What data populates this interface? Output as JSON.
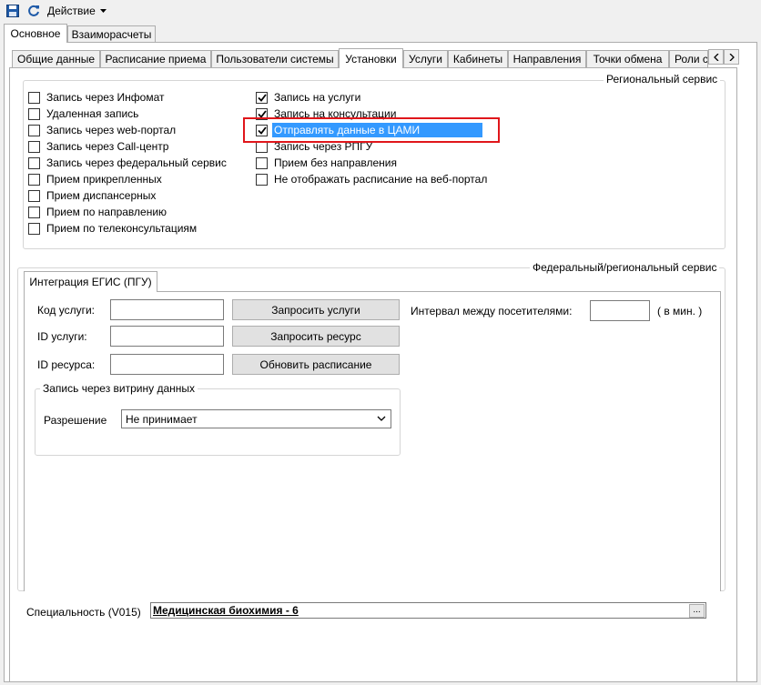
{
  "toolbar": {
    "save_icon": "save-icon",
    "refresh_icon": "refresh-icon",
    "action_label": "Действие"
  },
  "top_tabs": [
    {
      "label": "Основное",
      "active": true
    },
    {
      "label": "Взаиморасчеты",
      "active": false
    }
  ],
  "sub_tabs": [
    {
      "label": "Общие данные"
    },
    {
      "label": "Расписание приема"
    },
    {
      "label": "Пользователи системы"
    },
    {
      "label": "Установки",
      "active": true
    },
    {
      "label": "Услуги"
    },
    {
      "label": "Кабинеты"
    },
    {
      "label": "Направления"
    },
    {
      "label": "Точки обмена"
    },
    {
      "label": "Роли с"
    }
  ],
  "regional": {
    "title": "Региональный сервис",
    "left_checkboxes": [
      {
        "label": "Запись через Инфомат",
        "checked": false
      },
      {
        "label": "Удаленная запись",
        "checked": false
      },
      {
        "label": "Запись через web-портал",
        "checked": false
      },
      {
        "label": "Запись через Call-центр",
        "checked": false
      },
      {
        "label": "Запись через федеральный сервис",
        "checked": false
      },
      {
        "label": "Прием прикрепленных",
        "checked": false
      },
      {
        "label": "Прием диспансерных",
        "checked": false
      },
      {
        "label": "Прием по направлению",
        "checked": false
      },
      {
        "label": "Прием по телеконсультациям",
        "checked": false
      }
    ],
    "right_checkboxes": [
      {
        "label": "Запись на услуги",
        "checked": true
      },
      {
        "label": "Запись на консультации",
        "checked": true
      },
      {
        "label": "Отправлять данные в ЦАМИ",
        "checked": true,
        "selected": true
      },
      {
        "label": "Запись через РПГУ",
        "checked": false
      },
      {
        "label": "Прием без направления",
        "checked": false
      },
      {
        "label": "Не отображать расписание на веб-портал",
        "checked": false
      }
    ]
  },
  "federal": {
    "title": "Федеральный/региональный сервис",
    "tab_label": "Интеграция ЕГИС (ПГУ)",
    "service_code_label": "Код услуги:",
    "service_code_value": "",
    "service_id_label": "ID услуги:",
    "service_id_value": "",
    "resource_id_label": "ID ресурса:",
    "resource_id_value": "",
    "request_services_button": "Запросить услуги",
    "request_resource_button": "Запросить ресурс",
    "update_schedule_button": "Обновить расписание",
    "interval_label": "Интервал между посетителями:",
    "interval_value": "",
    "interval_unit": "( в мин. )",
    "showcase_group_title": "Запись через витрину данных",
    "permission_label": "Разрешение",
    "permission_value": "Не принимает"
  },
  "specialty": {
    "label": "Специальность (V015)",
    "value": "Медицинская биохимия - 6",
    "browse_button": "..."
  },
  "colors": {
    "highlight_border": "#e0161b",
    "selection": "#3399ff",
    "save_icon": "#1e5aa8"
  }
}
